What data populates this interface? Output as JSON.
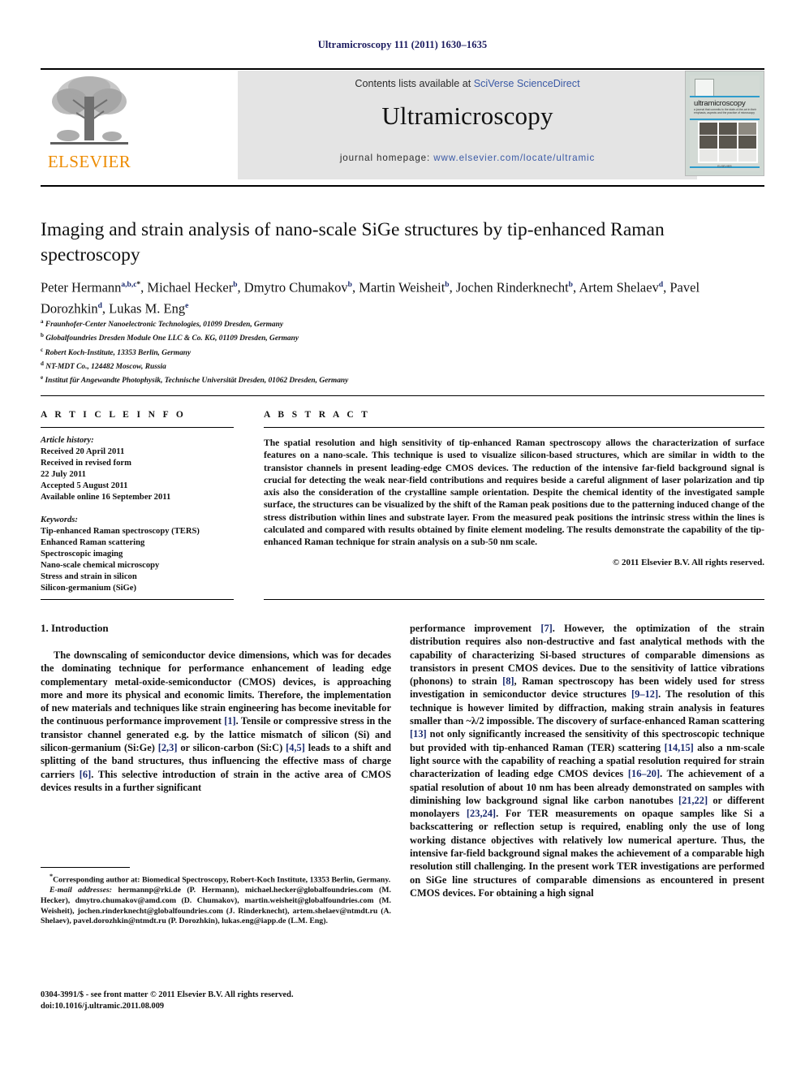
{
  "running_head": "Ultramicroscopy 111 (2011) 1630–1635",
  "masthead": {
    "contents_prefix": "Contents lists available at ",
    "contents_link": "SciVerse ScienceDirect",
    "journal_title": "Ultramicroscopy",
    "homepage_label": "journal homepage: ",
    "homepage_link": "www.elsevier.com/locate/ultramic",
    "publisher_wordmark": "ELSEVIER",
    "cover_title": "ultramicroscopy",
    "cover_subtitle": "a journal that commits to the state-of-the-art in their emphasis, aspects and the practice of microscopy",
    "cover_footer": "ELSEVIER",
    "link_color": "#3b5aa6",
    "wordmark_color": "#ed8b00"
  },
  "article": {
    "title": "Imaging and strain analysis of nano-scale SiGe structures by tip-enhanced Raman spectroscopy",
    "authors": [
      {
        "name": "Peter Hermann",
        "marks": "a,b,c",
        "corresponding": true
      },
      {
        "name": "Michael Hecker",
        "marks": "b"
      },
      {
        "name": "Dmytro Chumakov",
        "marks": "b"
      },
      {
        "name": "Martin Weisheit",
        "marks": "b"
      },
      {
        "name": "Jochen Rinderknecht",
        "marks": "b"
      },
      {
        "name": "Artem Shelaev",
        "marks": "d"
      },
      {
        "name": "Pavel Dorozhkin",
        "marks": "d"
      },
      {
        "name": "Lukas M. Eng",
        "marks": "e"
      }
    ],
    "affiliations": [
      {
        "mark": "a",
        "text": "Fraunhofer-Center Nanoelectronic Technologies, 01099 Dresden, Germany"
      },
      {
        "mark": "b",
        "text": "Globalfoundries Dresden Module One LLC & Co. KG, 01109 Dresden, Germany"
      },
      {
        "mark": "c",
        "text": "Robert Koch-Institute, 13353 Berlin, Germany"
      },
      {
        "mark": "d",
        "text": "NT-MDT Co., 124482 Moscow, Russia"
      },
      {
        "mark": "e",
        "text": "Institut für Angewandte Photophysik, Technische Universität Dresden, 01062 Dresden, Germany"
      }
    ]
  },
  "article_info": {
    "heading": "A R T I C L E  I N F O",
    "history_label": "Article history:",
    "history": [
      "Received 20 April 2011",
      "Received in revised form",
      "22 July 2011",
      "Accepted 5 August 2011",
      "Available online 16 September 2011"
    ],
    "keywords_label": "Keywords:",
    "keywords": [
      "Tip-enhanced Raman spectroscopy (TERS)",
      "Enhanced Raman scattering",
      "Spectroscopic imaging",
      "Nano-scale chemical microscopy",
      "Stress and strain in silicon",
      "Silicon-germanium (SiGe)"
    ]
  },
  "abstract": {
    "heading": "A B S T R A C T",
    "text": "The spatial resolution and high sensitivity of tip-enhanced Raman spectroscopy allows the characterization of surface features on a nano-scale. This technique is used to visualize silicon-based structures, which are similar in width to the transistor channels in present leading-edge CMOS devices. The reduction of the intensive far-field background signal is crucial for detecting the weak near-field contributions and requires beside a careful alignment of laser polarization and tip axis also the consideration of the crystalline sample orientation. Despite the chemical identity of the investigated sample surface, the structures can be visualized by the shift of the Raman peak positions due to the patterning induced change of the stress distribution within lines and substrate layer. From the measured peak positions the intrinsic stress within the lines is calculated and compared with results obtained by finite element modeling. The results demonstrate the capability of the tip-enhanced Raman technique for strain analysis on a sub-50 nm scale.",
    "copyright": "© 2011 Elsevier B.V. All rights reserved."
  },
  "body": {
    "section_heading": "1. Introduction",
    "left_paragraph_1": "The downscaling of semiconductor device dimensions, which was for decades the dominating technique for performance enhancement of leading edge complementary metal-oxide-semiconductor (CMOS) devices, is approaching more and more its physical and economic limits. Therefore, the implementation of new materials and techniques like strain engineering has become inevitable for the continuous performance improvement [1]. Tensile or compressive stress in the transistor channel generated e.g. by the lattice mismatch of silicon (Si) and silicon-germanium (Si:Ge) [2,3] or silicon-carbon (Si:C) [4,5] leads to a shift and splitting of the band structures, thus influencing the effective mass of charge carriers [6]. This selective introduction of strain in the active area of CMOS devices results in a further significant",
    "right_paragraph_1": "performance improvement [7]. However, the optimization of the strain distribution requires also non-destructive and fast analytical methods with the capability of characterizing Si-based structures of comparable dimensions as transistors in present CMOS devices. Due to the sensitivity of lattice vibrations (phonons) to strain [8], Raman spectroscopy has been widely used for stress investigation in semiconductor device structures [9–12]. The resolution of this technique is however limited by diffraction, making strain analysis in features smaller than ~λ/2 impossible. The discovery of surface-enhanced Raman scattering [13] not only significantly increased the sensitivity of this spectroscopic technique but provided with tip-enhanced Raman (TER) scattering [14,15] also a nm-scale light source with the capability of reaching a spatial resolution required for strain characterization of leading edge CMOS devices [16–20]. The achievement of a spatial resolution of about 10 nm has been already demonstrated on samples with diminishing low background signal like carbon nanotubes [21,22] or different monolayers [23,24]. For TER measurements on opaque samples like Si a backscattering or reflection setup is required, enabling only the use of long working distance objectives with relatively low numerical aperture. Thus, the intensive far-field background signal makes the achievement of a comparable high resolution still challenging. In the present work TER investigations are performed on SiGe line structures of comparable dimensions as encountered in present CMOS devices. For obtaining a high signal"
  },
  "footnote": {
    "corresponding": "Corresponding author at: Biomedical Spectroscopy, Robert-Koch Institute, 13353 Berlin, Germany.",
    "email_label": "E-mail addresses:",
    "emails": "hermannp@rki.de (P. Hermann), michael.hecker@globalfoundries.com (M. Hecker), dmytro.chumakov@amd.com (D. Chumakov), martin.weisheit@globalfoundries.com (M. Weisheit), jochen.rinderknecht@globalfoundries.com (J. Rinderknecht), artem.shelaev@ntmdt.ru (A. Shelaev), pavel.dorozhkin@ntmdt.ru (P. Dorozhkin), lukas.eng@iapp.de (L.M. Eng)."
  },
  "imprint": {
    "line1": "0304-3991/$ - see front matter © 2011 Elsevier B.V. All rights reserved.",
    "line2": "doi:10.1016/j.ultramic.2011.08.009"
  }
}
